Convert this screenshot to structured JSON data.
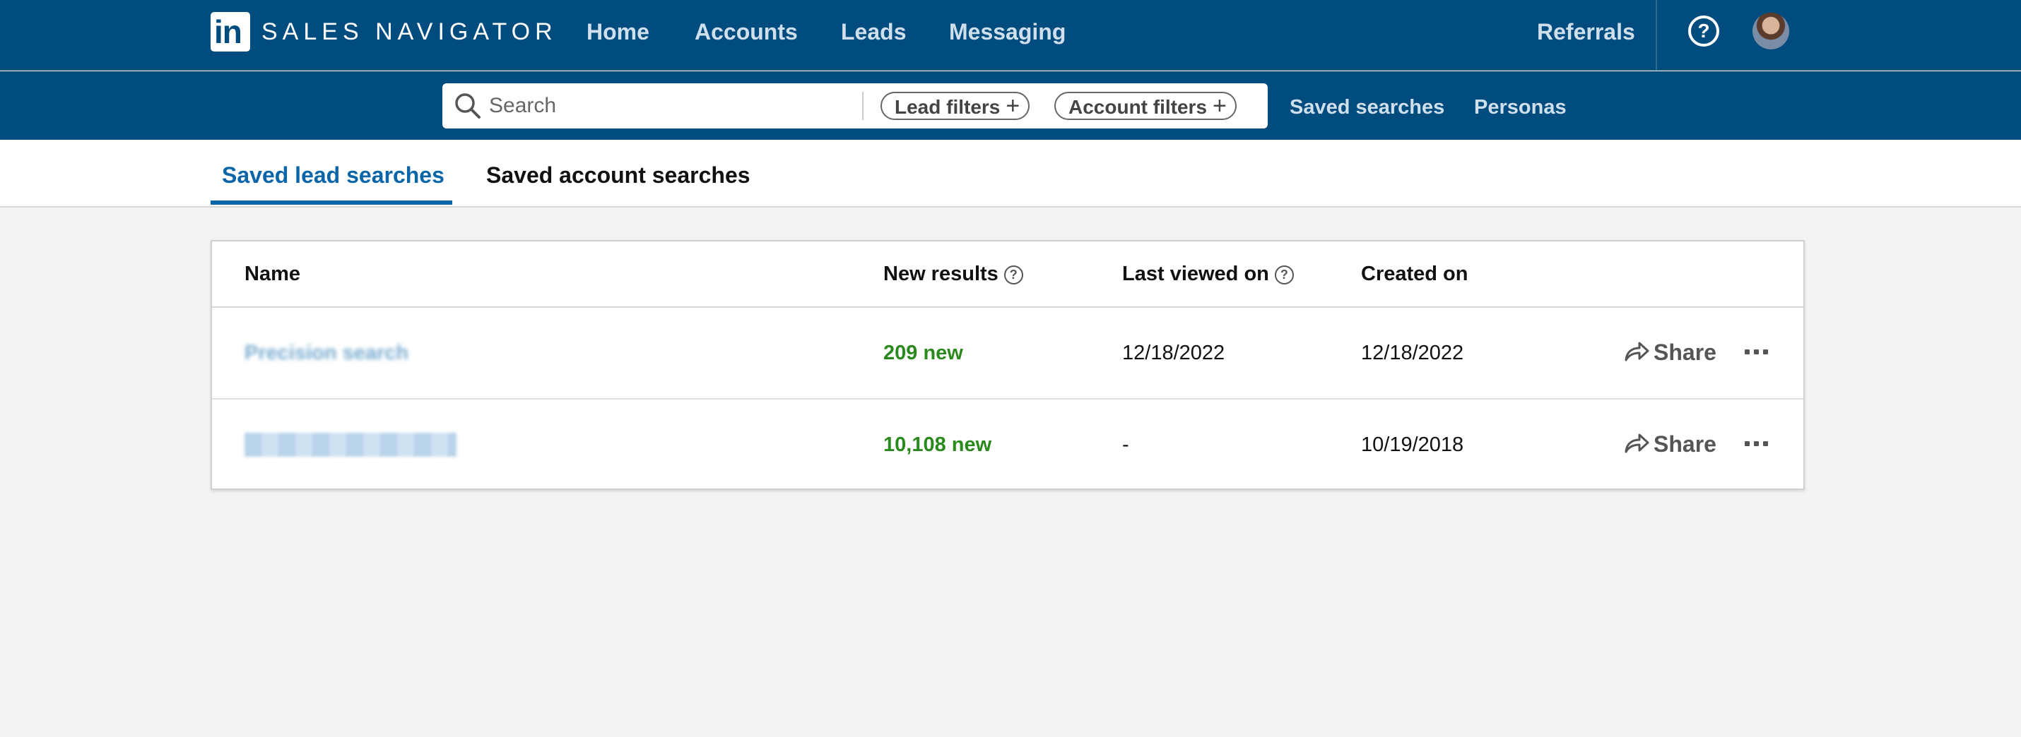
{
  "topnav": {
    "logo_text": "in",
    "brand": "SALES NAVIGATOR",
    "items": [
      "Home",
      "Accounts",
      "Leads",
      "Messaging"
    ],
    "referrals": "Referrals",
    "help_icon": "question-circle-icon",
    "avatar_icon": "user-avatar"
  },
  "search": {
    "placeholder": "Search",
    "lead_filters": "Lead filters",
    "account_filters": "Account filters",
    "plus": "+"
  },
  "subnav": {
    "saved_searches": "Saved searches",
    "personas": "Personas"
  },
  "tabs": {
    "leads": "Saved lead searches",
    "accounts": "Saved account searches",
    "active": "leads"
  },
  "table": {
    "headers": {
      "name": "Name",
      "new_results": "New results",
      "last_viewed": "Last viewed on",
      "created": "Created on"
    },
    "rows": [
      {
        "name": "Precision search",
        "new_results": "209 new",
        "last_viewed": "12/18/2022",
        "created": "12/18/2022",
        "share": "Share"
      },
      {
        "name": "",
        "new_results": "10,108 new",
        "last_viewed": "-",
        "created": "10/19/2018",
        "share": "Share"
      }
    ]
  },
  "colors": {
    "nav_bg": "#004c7f",
    "accent": "#0a66a8",
    "new_results": "#2b8a1e"
  }
}
